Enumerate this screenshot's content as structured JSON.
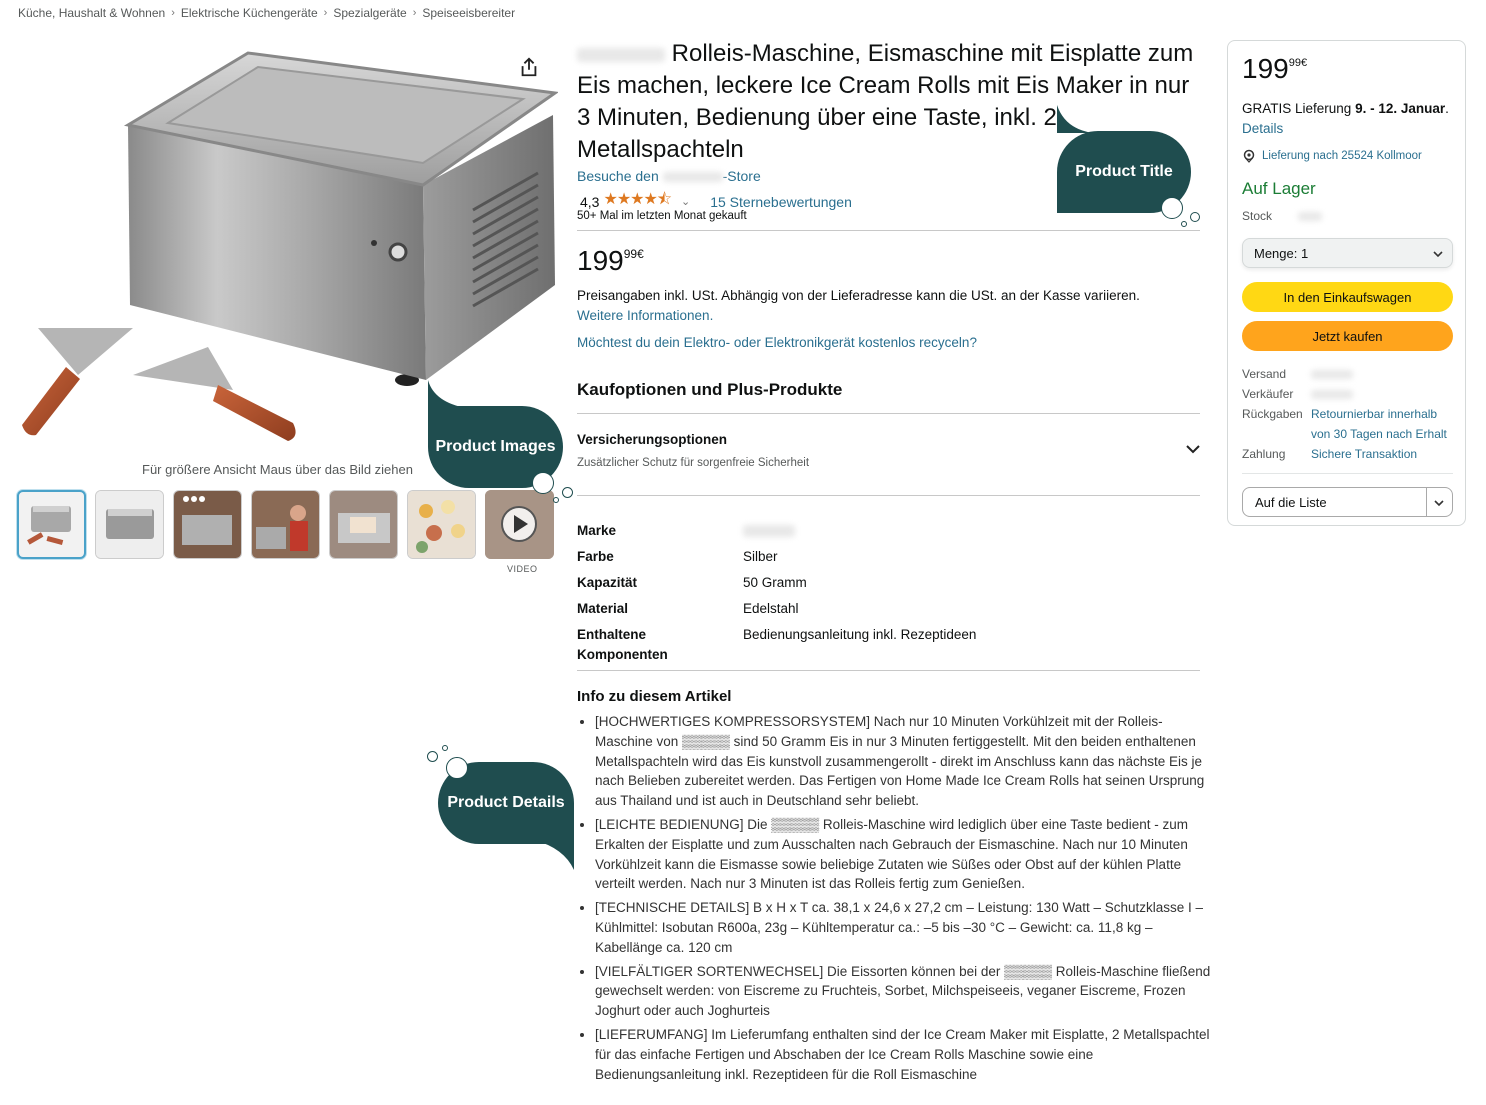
{
  "breadcrumb": [
    "Küche, Haushalt & Wohnen",
    "Elektrische Küchengeräte",
    "Spezialgeräte",
    "Speiseeisbereiter"
  ],
  "gallery": {
    "hint": "Für größere Ansicht Maus über das Bild ziehen",
    "video_label": "VIDEO"
  },
  "callouts": {
    "title": "Product Title",
    "images": "Product Images",
    "details": "Product Details"
  },
  "product": {
    "title": "Rolleis-Maschine, Eismaschine mit Eisplatte zum Eis machen, leckere Ice Cream Rolls mit Eis Maker in nur 3 Minuten, Bedienung über eine Taste, inkl. 2 Metallspachteln",
    "store_prefix": "Besuche den",
    "store_suffix": "-Store",
    "rating_value": "4,3",
    "rating_count": "15 Sternebewertungen",
    "bought": "50+ Mal im letzten Monat gekauft",
    "price_whole": "199",
    "price_fraction": "99",
    "currency": "€",
    "tax_note": "Preisangaben inkl. USt. Abhängig von der Lieferadresse kann die USt. an der Kasse variieren.",
    "more_info": "Weitere Informationen.",
    "recycle": "Möchtest du dein Elektro- oder Elektronikgerät kostenlos recyceln?",
    "options_heading": "Kaufoptionen und Plus-Produkte",
    "insurance_title": "Versicherungsoptionen",
    "insurance_sub": "Zusätzlicher Schutz für sorgenfreie Sicherheit"
  },
  "specs": [
    {
      "key": "Marke",
      "value": ""
    },
    {
      "key": "Farbe",
      "value": "Silber"
    },
    {
      "key": "Kapazität",
      "value": "50 Gramm"
    },
    {
      "key": "Material",
      "value": "Edelstahl"
    },
    {
      "key": "Enthaltene Komponenten",
      "value": "Bedienungsanleitung inkl. Rezeptideen"
    }
  ],
  "info": {
    "heading": "Info zu diesem Artikel",
    "bullets": [
      "[HOCHWERTIGES KOMPRESSORSYSTEM] Nach nur 10 Minuten Vorkühlzeit mit der Rolleis-Maschine von ▒▒▒▒▒ sind 50 Gramm Eis in nur 3 Minuten fertiggestellt. Mit den beiden enthaltenen Metallspachteln wird das Eis kunstvoll zusammengerollt - direkt im Anschluss kann das nächste Eis je nach Belieben zubereitet werden. Das Fertigen von Home Made Ice Cream Rolls hat seinen Ursprung aus Thailand und ist auch in Deutschland sehr beliebt.",
      "[LEICHTE BEDIENUNG] Die ▒▒▒▒▒ Rolleis-Maschine wird lediglich über eine Taste bedient - zum Erkalten der Eisplatte und zum Ausschalten nach Gebrauch der Eismaschine. Nach nur 10 Minuten Vorkühlzeit kann die Eismasse sowie beliebige Zutaten wie Süßes oder Obst auf der kühlen Platte verteilt werden. Nach nur 3 Minuten ist das Rolleis fertig zum Genießen.",
      "[TECHNISCHE DETAILS] B x H x T ca. 38,1 x 24,6 x 27,2 cm – Leistung: 130 Watt – Schutzklasse I – Kühlmittel: Isobutan R600a, 23g – Kühltemperatur ca.: –5 bis –30 °C – Gewicht: ca. 11,8 kg – Kabellänge ca. 120 cm",
      "[VIELFÄLTIGER SORTENWECHSEL] Die Eissorten können bei der ▒▒▒▒▒ Rolleis-Maschine fließend gewechselt werden: von Eiscreme zu Fruchteis, Sorbet, Milchspeiseeis, veganer Eiscreme, Frozen Joghurt oder auch Joghurteis",
      "[LIEFERUMFANG] Im Lieferumfang enthalten sind der Ice Cream Maker mit Eisplatte, 2 Metallspachtel für das einfache Fertigen und Abschaben der Ice Cream Rolls Maschine sowie eine Bedienungsanleitung inkl. Rezeptideen für die Roll Eismaschine"
    ]
  },
  "buybox": {
    "price_whole": "199",
    "price_fraction": "99",
    "currency": "€",
    "delivery_prefix": "GRATIS Lieferung",
    "delivery_dates": "9. - 12. Januar",
    "delivery_link": "Details",
    "location": "Lieferung nach 25524 Kollmoor",
    "stock_status": "Auf Lager",
    "stock_label": "Stock",
    "stock_value": "470",
    "quantity_label": "Menge:",
    "quantity_value": "1",
    "add_to_cart": "In den Einkaufswagen",
    "buy_now": "Jetzt kaufen",
    "shipping_label": "Versand",
    "seller_label": "Verkäufer",
    "returns_label": "Rückgaben",
    "returns_value": "Retournierbar innerhalb von 30 Tagen nach Erhalt",
    "payment_label": "Zahlung",
    "payment_value": "Sichere Transaktion",
    "wishlist": "Auf die Liste"
  },
  "colors": {
    "callout": "#1f4d4f",
    "link": "#2a6f8f",
    "stars": "#de7921",
    "cart_button": "#ffd814",
    "buy_button": "#ffa41c",
    "in_stock": "#1b7d35"
  }
}
